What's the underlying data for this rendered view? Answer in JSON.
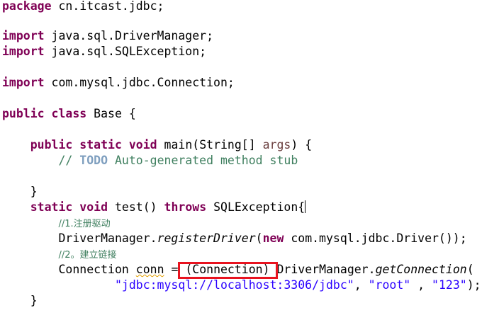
{
  "code": {
    "package_kw": "package",
    "package_name": " cn.itcast.jdbc;",
    "import_kw": "import",
    "import1": " java.sql.DriverManager;",
    "import2": " java.sql.SQLException;",
    "import3": " com.mysql.jdbc.Connection;",
    "public_kw": "public",
    "class_kw": "class",
    "class_name": " Base {",
    "indent1": "    ",
    "indent2": "        ",
    "indent3": "                ",
    "static_kw": "static",
    "void_kw": "void",
    "main_sig": " main(String[] ",
    "args": "args",
    "main_end": ") {",
    "comment_prefix": "// ",
    "todo": "TODO",
    "comment_rest": " Auto-generated method stub",
    "close_brace": "}",
    "test_sig": " test() ",
    "throws_kw": "throws",
    "test_end": " SQLException{",
    "comment1": "//1.注册驱动",
    "register_pre": "DriverManager.",
    "register_method": "registerDriver",
    "paren_open": "(",
    "new_kw": "new",
    "register_arg": " com.mysql.jdbc.Driver());",
    "comment2": "//2。建立链接",
    "conn_type": "Connection ",
    "conn_var": "conn",
    "conn_assign": " = ",
    "conn_cast": "(Connection)",
    "conn_dm": " DriverManager.",
    "conn_method": "getConnection",
    "conn_paren": "(",
    "url_str": "\"jdbc:mysql://localhost:3306/jdbc\"",
    "sep1": ", ",
    "user_str": "\"root\"",
    "sep2": " , ",
    "pass_str": "\"123\"",
    "end_call": ");"
  },
  "colors": {
    "keyword": "#7f0055",
    "comment": "#3f7f5f",
    "todo": "#7f9fbf",
    "string": "#2a00ff",
    "highlight_box": "#e8131f"
  }
}
